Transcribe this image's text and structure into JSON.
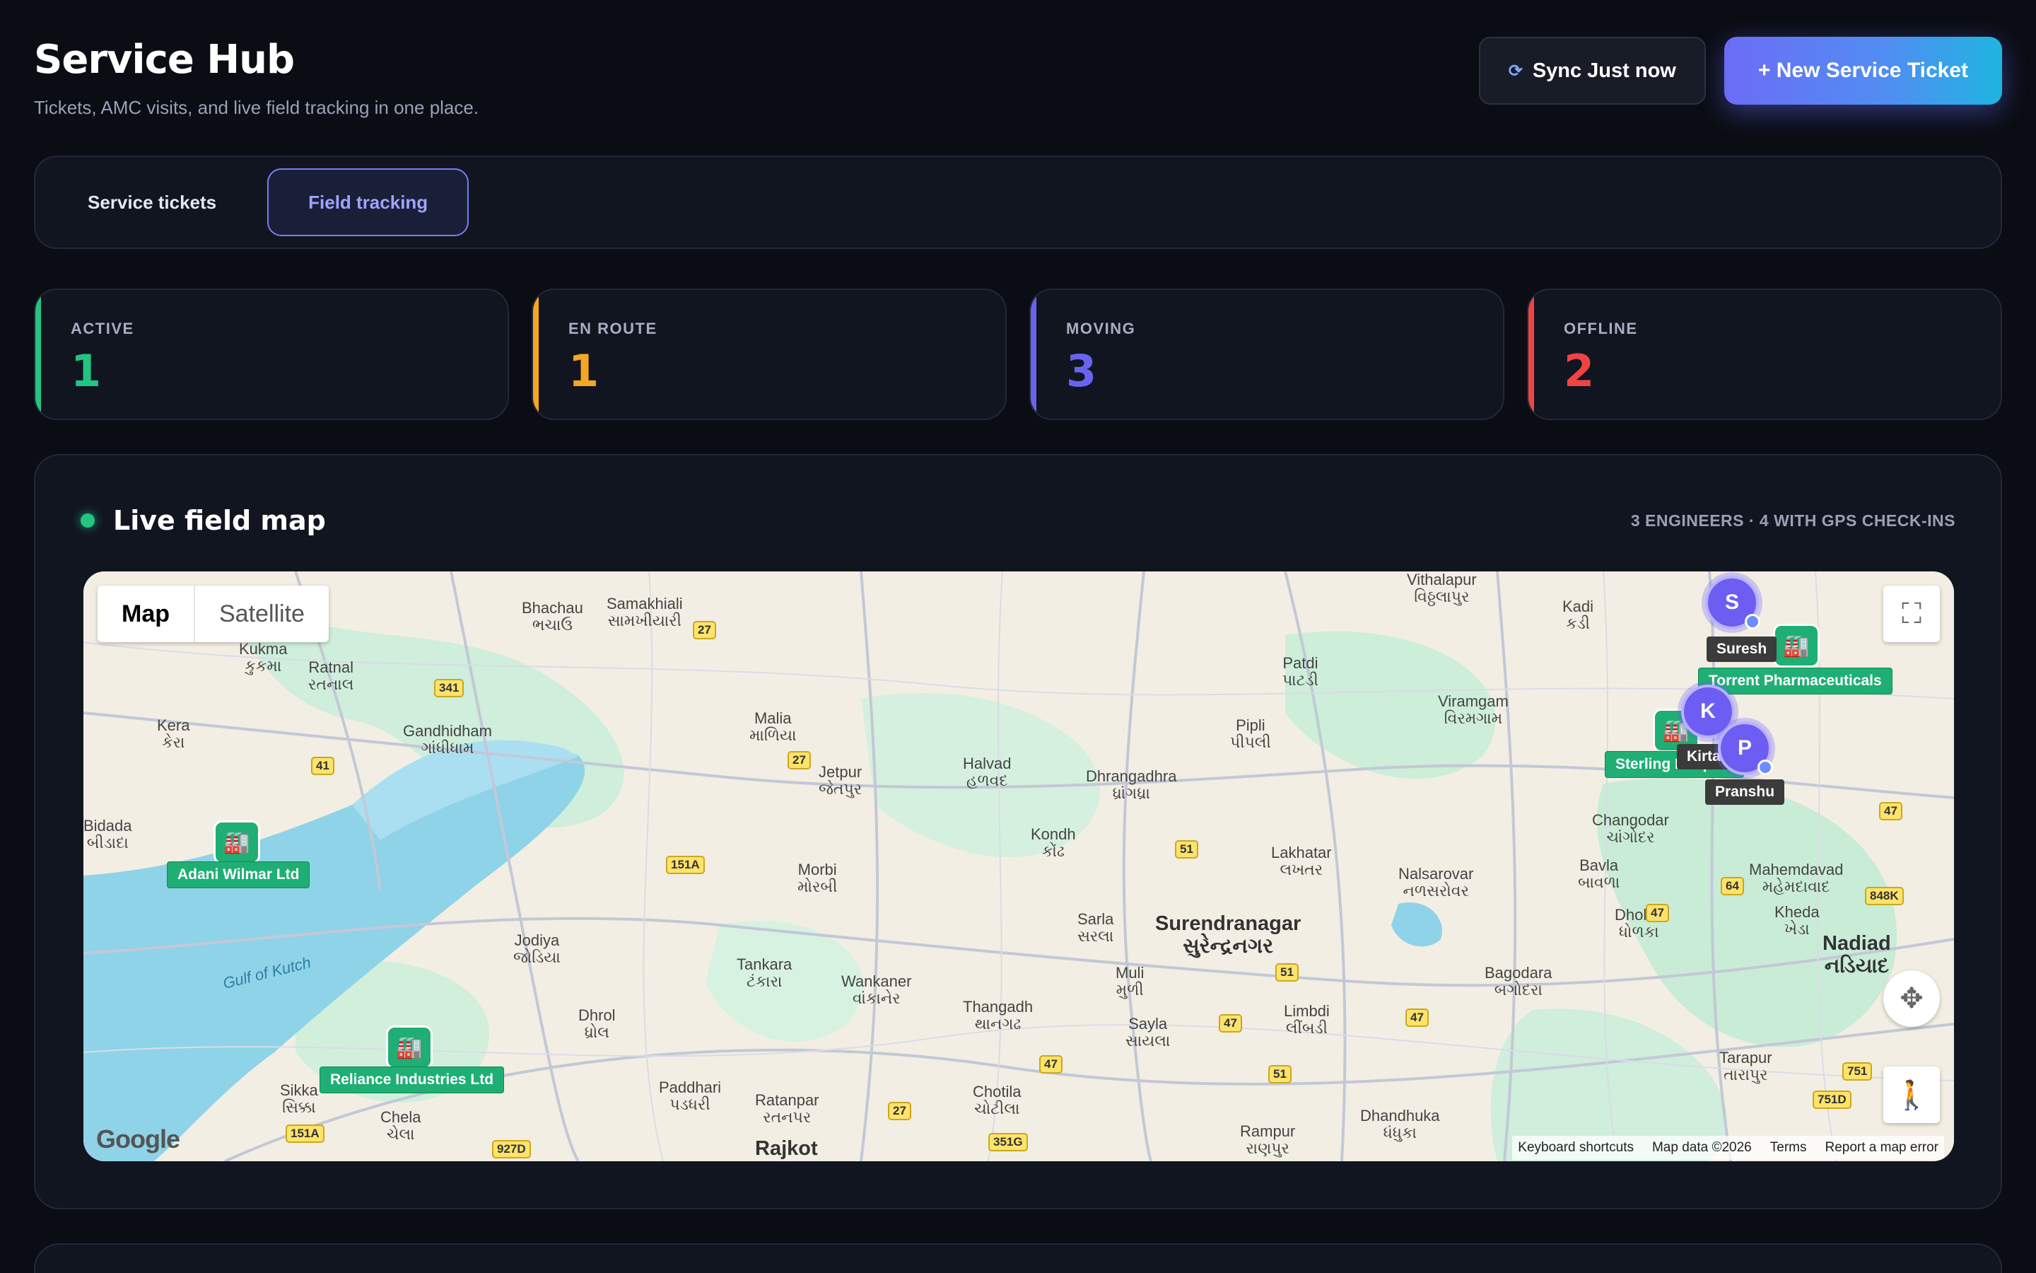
{
  "header": {
    "title": "Service Hub",
    "subtitle": "Tickets, AMC visits, and live field tracking in one place.",
    "sync_label": "Sync Just now",
    "new_ticket_label": "+ New Service Ticket"
  },
  "tabs": [
    {
      "label": "Service tickets",
      "active": false
    },
    {
      "label": "Field tracking",
      "active": true
    }
  ],
  "stats": [
    {
      "label": "ACTIVE",
      "value": "1",
      "color": "#22c580"
    },
    {
      "label": "EN ROUTE",
      "value": "1",
      "color": "#f5a623"
    },
    {
      "label": "MOVING",
      "value": "3",
      "color": "#6a63f0"
    },
    {
      "label": "OFFLINE",
      "value": "2",
      "color": "#ee4444"
    }
  ],
  "map": {
    "title": "Live field map",
    "meta": "3 ENGINEERS · 4 WITH GPS CHECK-INS",
    "map_type": {
      "map": "Map",
      "satellite": "Satellite"
    },
    "footer": [
      "Keyboard shortcuts",
      "Map data ©2026",
      "Terms",
      "Report a map error"
    ],
    "logo": "Google",
    "clients": [
      "Adani Wilmar Ltd",
      "Reliance Industries Ltd",
      "Torrent Pharmaceuticals",
      "Sterling Hospital"
    ],
    "engineers": [
      {
        "initial": "S",
        "name": "Suresh"
      },
      {
        "initial": "K",
        "name": "Kirtan"
      },
      {
        "initial": "P",
        "name": "Pranshu"
      }
    ],
    "places": [
      "Bhachau\nભચાઉ",
      "Samakhiali\nસામખીયારી",
      "Kukma\nકુકમા",
      "Ratnal\nરતનાલ",
      "Kera\nકેરા",
      "Gandhidham\nગાંધીધામ",
      "Bidada\nબીડાદા",
      "Malia\nમાળિયા",
      "Jetpur\nજેતપુર",
      "Halvad\nહળવદ",
      "Dhrangadhra\nધ્રાંગધ્રા",
      "Pipli\nપીપલી",
      "Patdi\nપાટડી",
      "Viramgam\nવિરમગામ",
      "Kadi\nકડી",
      "Kondh\nકોંઢ",
      "Morbi\nમોરબી",
      "Lakhatar\nલખતર",
      "Nalsarovar\nનળસરોવર",
      "Changodar\nચાંગોદર",
      "Bavla\nબાવળા",
      "Dholka\nધોળકા",
      "Mahemdavad\nમહેમદાવાદ",
      "Kheda\nખેડા",
      "Jodiya\nજોડિયા",
      "Tankara\nટંકારા",
      "Wankaner\nવાંકાનેર",
      "Sarla\nસરલા",
      "Muli\nમુળી",
      "Thangadh\nથાનગઢ",
      "Sayla\nસાયલા",
      "Limbdi\nલીંબડી",
      "Bagodara\nબગોદરા",
      "Dhrol\nધ્રોલ",
      "Paddhari\nપડધરી",
      "Ratanpar\nરતનપર",
      "Chotila\nચોટીલા",
      "Rajkot",
      "Rampur\nરાણપુર",
      "Dhandhuka\nધંધુકા",
      "Tarapur\nતારાપુર",
      "Sikka\nસિક્કા",
      "Chela\nચેલા",
      "Vithalapur\nવિઠ્ઠલાપુર"
    ],
    "big_places": [
      "Surendranagar\nસુરેન્દ્રનગર",
      "Nadiad\nનડિયાદ"
    ],
    "water_label": "Gulf of Kutch",
    "roads": [
      "27",
      "341",
      "41",
      "27",
      "151A",
      "51",
      "51",
      "47",
      "47",
      "51",
      "47",
      "27",
      "351G",
      "927D",
      "151A",
      "751",
      "751D",
      "64",
      "47",
      "848K",
      "47"
    ]
  }
}
